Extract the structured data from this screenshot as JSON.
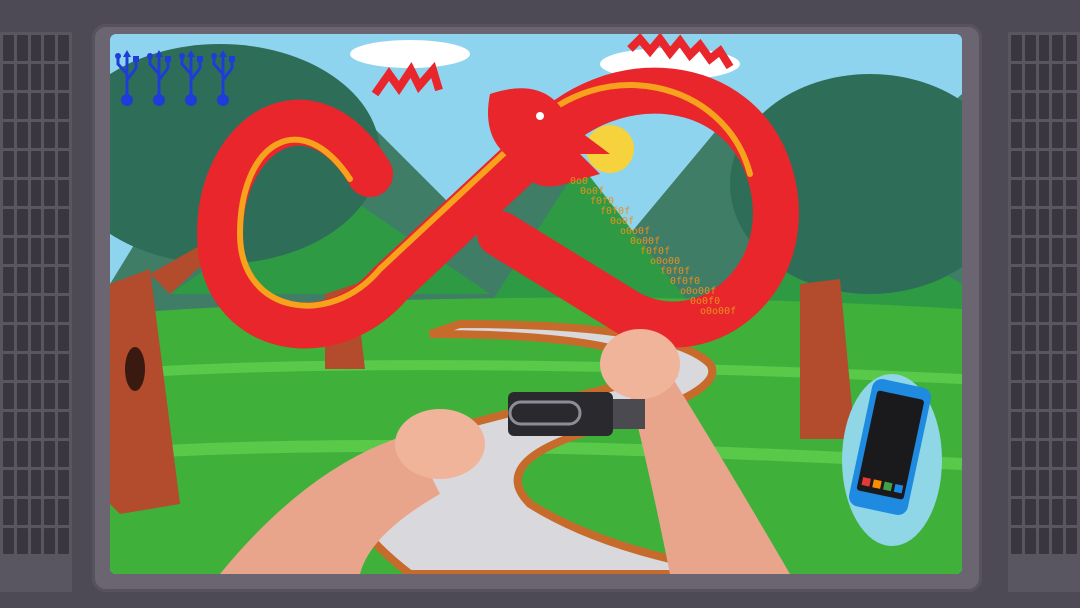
{
  "hud": {
    "lives": {
      "count": 4,
      "icon": "usb-trident-icon",
      "color": "#1f3dd6"
    },
    "device_badge": {
      "icon": "smartphone-icon",
      "app_colors": [
        "#e53935",
        "#fb8c00",
        "#43a047",
        "#1e88e5"
      ]
    }
  },
  "scene": {
    "enemy": {
      "type": "red-infinity-dragon",
      "body_color": "#e8262b",
      "belly_color": "#f6a21c"
    },
    "data_stream": {
      "color": "#e8901e",
      "lines": [
        "0o0",
        "0o0f",
        "f0f0",
        "f0f0f",
        "0o0f",
        "o0o0f",
        "0o00f",
        "f0f0f",
        "o0o00",
        "f0f0f",
        "0f0f0",
        "o0o00f",
        "0o0f0",
        "o0o00f"
      ]
    },
    "held_item": "usb-flash-drive"
  },
  "colors": {
    "bezel": "#6a6570",
    "grass": "#3fb13a",
    "sky": "#8fd4ee",
    "path": "#d9d8dc"
  }
}
